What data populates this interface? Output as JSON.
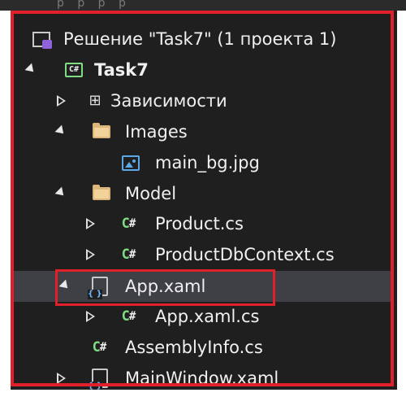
{
  "top_strip_text": "р   р   р  р",
  "tree": {
    "solution": {
      "label": "Решение \"Task7\"  (1 проекта 1)",
      "icon": "solution-icon"
    },
    "project": {
      "label": "Task7",
      "icon": "csharp-project-icon"
    },
    "dependencies": {
      "label": "Зависимости",
      "icon": "dependencies-icon"
    },
    "images_folder": {
      "label": "Images",
      "icon": "folder-icon"
    },
    "main_bg": {
      "label": "main_bg.jpg",
      "icon": "image-file-icon"
    },
    "model_folder": {
      "label": "Model",
      "icon": "folder-icon"
    },
    "product": {
      "label": "Product.cs",
      "icon_text": "C",
      "icon": "csharp-file-icon"
    },
    "product_db": {
      "label": "ProductDbContext.cs",
      "icon_text": "C",
      "icon": "csharp-file-icon"
    },
    "app_xaml": {
      "label": "App.xaml",
      "icon": "xaml-file-icon",
      "selected": true
    },
    "app_xaml_cs": {
      "label": "App.xaml.cs",
      "icon_text": "C",
      "icon": "csharp-file-icon"
    },
    "assembly_info": {
      "label": "AssemblyInfo.cs",
      "icon_text": "C",
      "icon": "csharp-file-icon"
    },
    "main_window": {
      "label": "MainWindow.xaml",
      "icon": "xaml-file-icon"
    }
  },
  "hash_glyph": "#",
  "project_icon_text": "C#",
  "colors": {
    "background": "#1f1f1f",
    "selection": "#3f3f46",
    "highlight_border": "#e0202a",
    "csharp_green": "#7fdc82",
    "folder": "#dcb67a",
    "solution_purple": "#8e62d9"
  }
}
